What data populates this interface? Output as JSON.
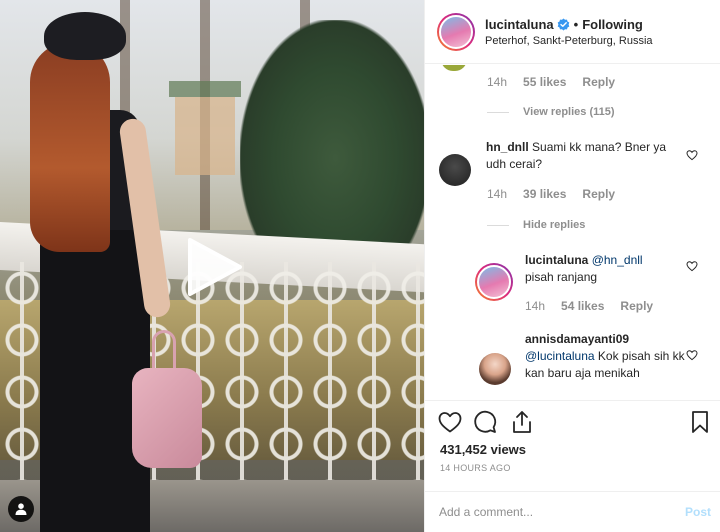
{
  "post": {
    "username": "lucintaluna",
    "following_label": "Following",
    "location": "Peterhof, Sankt-Peterburg, Russia",
    "views": "431,452 views",
    "time": "14 HOURS AGO"
  },
  "comments": [
    {
      "time": "14h",
      "likes": "55 likes",
      "reply": "Reply",
      "toggle": "View replies (115)"
    },
    {
      "username": "hn_dnll",
      "text": "Suami kk mana? Bner ya udh cerai?",
      "time": "14h",
      "likes": "39 likes",
      "reply": "Reply",
      "toggle": "Hide replies"
    }
  ],
  "replies": [
    {
      "username": "lucintaluna",
      "mention": "@hn_dnll",
      "text": "pisah ranjang",
      "time": "14h",
      "likes": "54 likes",
      "reply": "Reply"
    },
    {
      "username": "annisdamayanti09",
      "mention": "@lucintaluna",
      "text": "Kok pisah sih kk kan baru aja menikah"
    }
  ],
  "composer": {
    "placeholder": "Add a comment...",
    "post_label": "Post"
  },
  "icons": {
    "play": "play-icon",
    "verified": "verified-badge-icon",
    "heart": "heart-icon",
    "comment": "comment-icon",
    "share": "share-icon",
    "save": "bookmark-icon",
    "user": "user-tag-icon"
  },
  "colors": {
    "verified": "#3897f0",
    "link": "#00376b",
    "post_disabled": "#b2dffc",
    "muted": "#8e8e8e"
  }
}
